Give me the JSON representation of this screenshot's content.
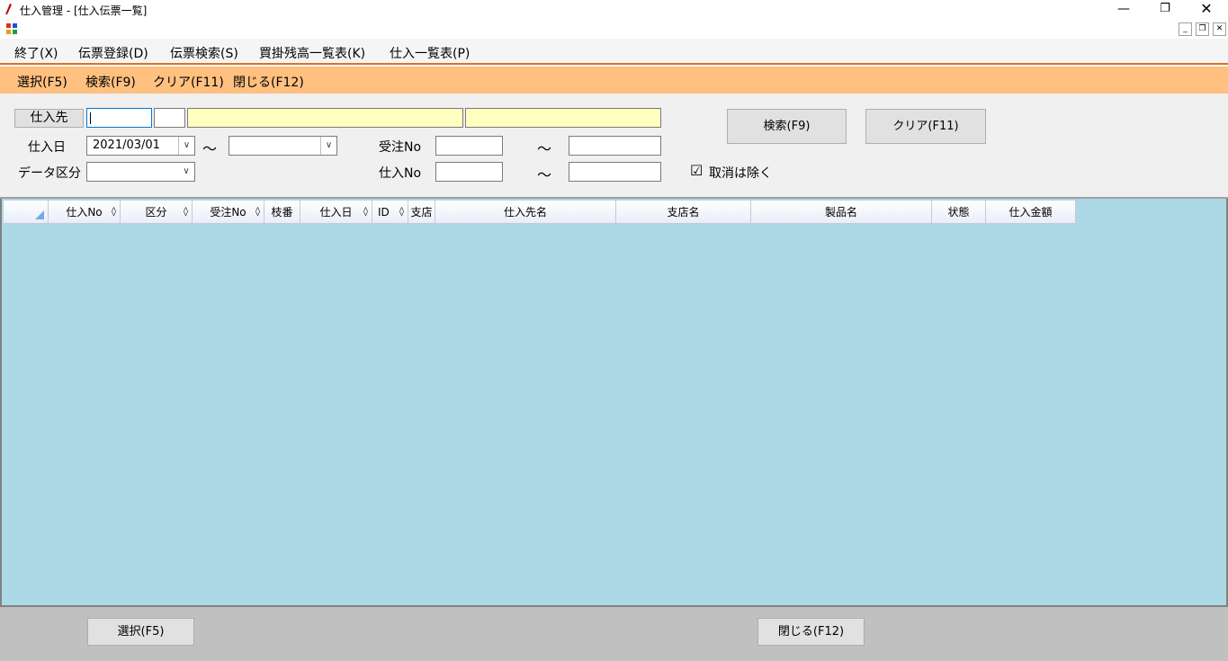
{
  "window": {
    "title": "仕入管理 - [仕入伝票一覧]",
    "minimize": "—",
    "maximize": "❐",
    "close": "✕"
  },
  "mdi": {
    "minimize": "_",
    "restore": "❐",
    "close": "✕"
  },
  "menu": {
    "items": [
      "終了(X)",
      "伝票登録(D)",
      "伝票検索(S)",
      "買掛残高一覧表(K)",
      "仕入一覧表(P)"
    ]
  },
  "toolbar": {
    "items": [
      "選択(F5)",
      "検索(F9)",
      "クリア(F11)",
      "閉じる(F12)"
    ]
  },
  "search": {
    "supplier_button": "仕入先",
    "supplier_code": "",
    "supplier_branch": "",
    "supplier_name": "",
    "supplier_branch_name": "",
    "purchase_date_label": "仕入日",
    "purchase_date_from": "2021/03/01",
    "purchase_date_to": "",
    "range_tilde": "～",
    "data_kind_label": "データ区分",
    "data_kind_value": "",
    "order_no_label": "受注No",
    "order_no_from": "",
    "order_no_to": "",
    "purchase_no_label": "仕入No",
    "purchase_no_from": "",
    "purchase_no_to": "",
    "exclude_cancelled_label": "取消は除く",
    "exclude_cancelled_checked": true,
    "check_mark": "☑",
    "search_button": "検索(F9)",
    "clear_button": "クリア(F11)"
  },
  "grid": {
    "sort_glyph": "◊",
    "columns": [
      {
        "label": "",
        "sortable": false
      },
      {
        "label": "仕入No",
        "sortable": true
      },
      {
        "label": "区分",
        "sortable": true
      },
      {
        "label": "受注No",
        "sortable": true
      },
      {
        "label": "枝番",
        "sortable": false
      },
      {
        "label": "仕入日",
        "sortable": true
      },
      {
        "label": "ID",
        "sortable": true
      },
      {
        "label": "支店",
        "sortable": false
      },
      {
        "label": "仕入先名",
        "sortable": false
      },
      {
        "label": "支店名",
        "sortable": false
      },
      {
        "label": "製品名",
        "sortable": false
      },
      {
        "label": "状態",
        "sortable": false
      },
      {
        "label": "仕入金額",
        "sortable": false
      }
    ],
    "rows": []
  },
  "footer": {
    "select_button": "選択(F5)",
    "close_button": "閉じる(F12)"
  },
  "colors": {
    "menu_accent": "#e07020",
    "toolbar_bg": "#ffc080",
    "grid_bg": "#add8e6",
    "name_field_bg": "#ffffc0"
  }
}
